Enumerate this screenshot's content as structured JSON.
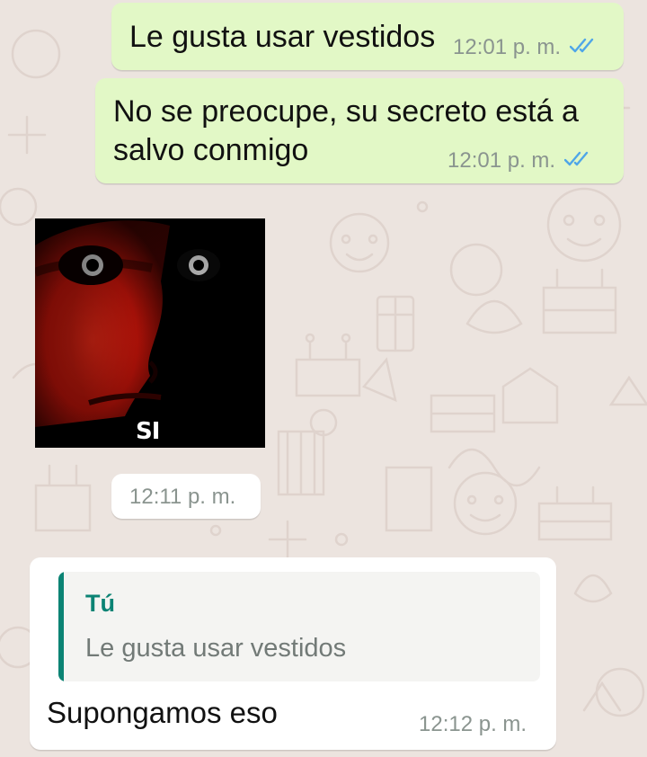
{
  "messages": [
    {
      "direction": "outgoing",
      "text": "Le gusta usar vestidos",
      "time": "12:01 p. m.",
      "status": "read-double-check"
    },
    {
      "direction": "outgoing",
      "text": "No se preocupe, su secreto está a salvo conmigo",
      "time": "12:01 p. m.",
      "status": "read-double-check"
    },
    {
      "direction": "incoming",
      "type": "sticker",
      "sticker_caption": "SI",
      "time": "12:11 p. m."
    },
    {
      "direction": "incoming",
      "quote": {
        "author": "Tú",
        "text": "Le gusta usar vestidos"
      },
      "text": "Supongamos eso",
      "time": "12:12 p. m."
    }
  ],
  "colors": {
    "outgoing_bubble": "#e2f8c6",
    "incoming_bubble": "#ffffff",
    "chat_background": "#ece4df",
    "read_ticks": "#4fa6e8",
    "quote_accent": "#0b8374",
    "timestamp": "#8a948f"
  },
  "icons": [
    "double-check-icon"
  ]
}
